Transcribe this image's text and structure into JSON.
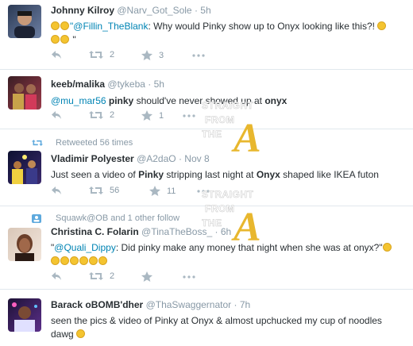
{
  "tweets": [
    {
      "name": "Johnny Kilroy",
      "handle": "@Narv_Got_Sole",
      "time": "· 5h",
      "text_mention": "\"@Fillin_TheBlank",
      "text_body": ": Why would Pinky show up to Onyx looking like this?! ",
      "text_line2": " \"",
      "retweets": "2",
      "favorites": "3"
    },
    {
      "name": "keeb/malika",
      "handle": "@tykeba",
      "time": "· 5h",
      "text_mention": "@mu_mar56",
      "text_b1": "pinky",
      "text_mid": " should've never showed up at ",
      "text_b2": "onyx",
      "retweets": "2",
      "favorites": "1"
    },
    {
      "context": "Retweeted 56 times",
      "name": "Vladimir Polyester",
      "handle": "@A2daO",
      "time": "· Nov 8",
      "text_pre": "Just seen a video of ",
      "text_b1": "Pinky",
      "text_mid": " stripping last night at ",
      "text_b2": "Onyx",
      "text_post": " shaped like IKEA futon",
      "retweets": "56",
      "favorites": "11"
    },
    {
      "context": "Squawk@OB and 1 other follow",
      "name": "Christina C. Folarin",
      "handle": "@TinaTheBoss_",
      "time": "· 6h",
      "text_pre": "\"",
      "text_mention": "@Quali_Dippy",
      "text_body": ": Did pinky make any money that night when she was at onyx?\"",
      "retweets": "2"
    },
    {
      "name": "Barack oBOMB'dher",
      "handle": "@ThaSwaggernator",
      "time": "· 7h",
      "text_pre": "seen the pics & video of ",
      "text_b1": "Pinky",
      "text_mid": " at ",
      "text_b2": "Onyx",
      "text_post": " & almost upchucked my cup of noodles",
      "text_line2": "dawg"
    }
  ],
  "watermark": {
    "line1": "STRAIGHT",
    "line2": "FROM",
    "line3": "THE",
    "mark": "A"
  },
  "colors": {
    "link": "#0084b4",
    "meta": "#8899a6",
    "divider": "#e1e8ed",
    "watermark_gold": "#e8b72e"
  },
  "icons": [
    "reply-icon",
    "retweet-icon",
    "favorite-icon",
    "more-icon",
    "retweet-context-icon",
    "follow-context-icon"
  ]
}
